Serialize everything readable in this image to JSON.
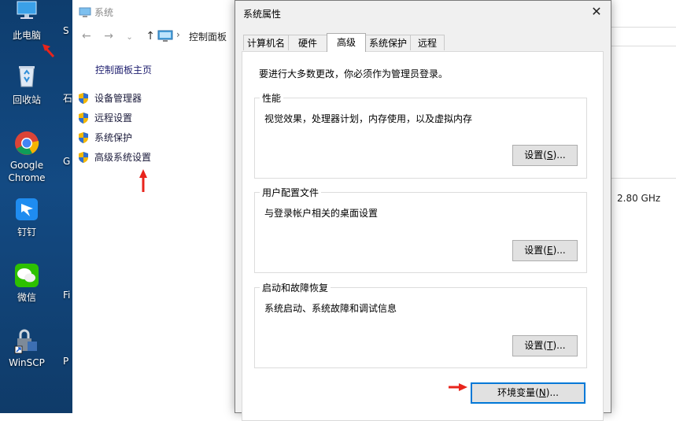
{
  "desktop": {
    "icons": [
      {
        "label": "此电脑",
        "icon": "computer-icon"
      },
      {
        "label": "回收站",
        "icon": "recycle-bin-icon"
      },
      {
        "label": "Google Chrome",
        "icon": "chrome-icon"
      },
      {
        "label": "钉钉",
        "icon": "dingtalk-icon"
      },
      {
        "label": "微信",
        "icon": "wechat-icon"
      },
      {
        "label": "WinSCP",
        "icon": "winscp-icon"
      }
    ],
    "clipped": [
      "S",
      "石",
      "G",
      "Fi",
      "P"
    ]
  },
  "bg_window": {
    "title": "系统",
    "address": "控制面板",
    "home_link": "控制面板主页",
    "links": [
      "设备管理器",
      "远程设置",
      "系统保护",
      "高级系统设置"
    ],
    "cpu_speed": "2.80 GHz"
  },
  "dialog": {
    "title": "系统属性",
    "tabs": [
      "计算机名",
      "硬件",
      "高级",
      "系统保护",
      "远程"
    ],
    "active_tab": "高级",
    "admin_note": "要进行大多数更改，你必须作为管理员登录。",
    "groups": [
      {
        "title": "性能",
        "desc": "视觉效果，处理器计划，内存使用，以及虚拟内存",
        "btn_pre": "设置(",
        "btn_key": "S",
        "btn_post": ")..."
      },
      {
        "title": "用户配置文件",
        "desc": "与登录帐户相关的桌面设置",
        "btn_pre": "设置(",
        "btn_key": "E",
        "btn_post": ")..."
      },
      {
        "title": "启动和故障恢复",
        "desc": "系统启动、系统故障和调试信息",
        "btn_pre": "设置(",
        "btn_key": "T",
        "btn_post": ")..."
      }
    ],
    "env_btn_pre": "环境变量(",
    "env_btn_key": "N",
    "env_btn_post": ")..."
  },
  "colors": {
    "accent": "#0078d7",
    "arrow": "#e8241c",
    "desktop_bg": "#134a83"
  }
}
